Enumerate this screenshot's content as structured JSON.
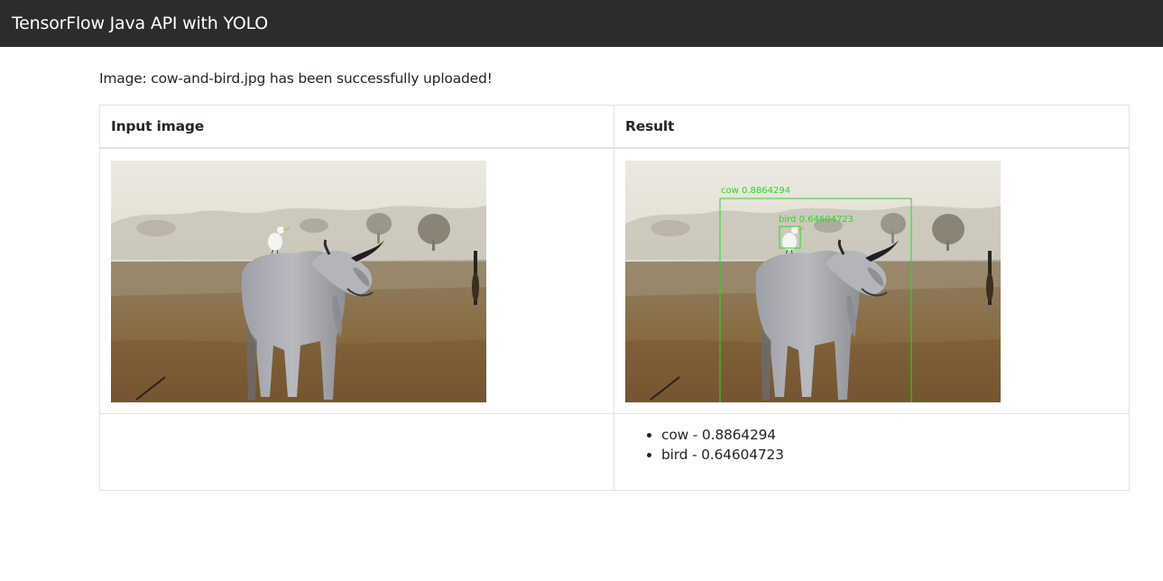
{
  "app": {
    "title": "TensorFlow Java API with YOLO"
  },
  "status": {
    "message": "Image: cow-and-bird.jpg has been successfully uploaded!"
  },
  "table": {
    "headers": [
      "Input image",
      "Result"
    ]
  },
  "detections": [
    {
      "label": "cow",
      "score": "0.8864294",
      "text": "cow - 0.8864294",
      "box_label": "cow 0.8864294"
    },
    {
      "label": "bird",
      "score": "0.64604723",
      "text": "bird - 0.64604723",
      "box_label": "bird 0.64604723"
    }
  ],
  "colors": {
    "navbar": "#2b2c2d",
    "detection_box": "#22dd22",
    "table_border": "#dee2e6"
  }
}
